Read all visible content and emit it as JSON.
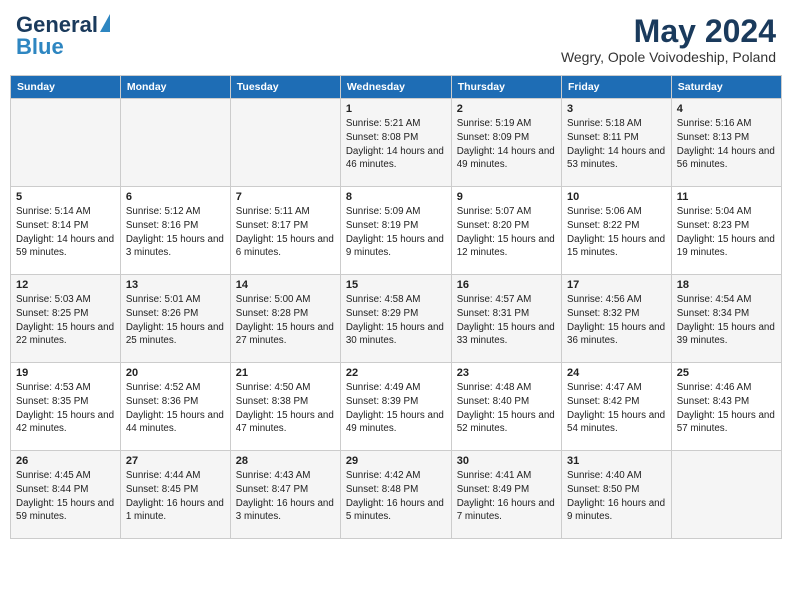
{
  "header": {
    "logo_line1": "General",
    "logo_line2": "Blue",
    "month_title": "May 2024",
    "location": "Wegry, Opole Voivodeship, Poland"
  },
  "columns": [
    "Sunday",
    "Monday",
    "Tuesday",
    "Wednesday",
    "Thursday",
    "Friday",
    "Saturday"
  ],
  "weeks": [
    [
      {
        "day": "",
        "sunrise": "",
        "sunset": "",
        "daylight": ""
      },
      {
        "day": "",
        "sunrise": "",
        "sunset": "",
        "daylight": ""
      },
      {
        "day": "",
        "sunrise": "",
        "sunset": "",
        "daylight": ""
      },
      {
        "day": "1",
        "sunrise": "Sunrise: 5:21 AM",
        "sunset": "Sunset: 8:08 PM",
        "daylight": "Daylight: 14 hours and 46 minutes."
      },
      {
        "day": "2",
        "sunrise": "Sunrise: 5:19 AM",
        "sunset": "Sunset: 8:09 PM",
        "daylight": "Daylight: 14 hours and 49 minutes."
      },
      {
        "day": "3",
        "sunrise": "Sunrise: 5:18 AM",
        "sunset": "Sunset: 8:11 PM",
        "daylight": "Daylight: 14 hours and 53 minutes."
      },
      {
        "day": "4",
        "sunrise": "Sunrise: 5:16 AM",
        "sunset": "Sunset: 8:13 PM",
        "daylight": "Daylight: 14 hours and 56 minutes."
      }
    ],
    [
      {
        "day": "5",
        "sunrise": "Sunrise: 5:14 AM",
        "sunset": "Sunset: 8:14 PM",
        "daylight": "Daylight: 14 hours and 59 minutes."
      },
      {
        "day": "6",
        "sunrise": "Sunrise: 5:12 AM",
        "sunset": "Sunset: 8:16 PM",
        "daylight": "Daylight: 15 hours and 3 minutes."
      },
      {
        "day": "7",
        "sunrise": "Sunrise: 5:11 AM",
        "sunset": "Sunset: 8:17 PM",
        "daylight": "Daylight: 15 hours and 6 minutes."
      },
      {
        "day": "8",
        "sunrise": "Sunrise: 5:09 AM",
        "sunset": "Sunset: 8:19 PM",
        "daylight": "Daylight: 15 hours and 9 minutes."
      },
      {
        "day": "9",
        "sunrise": "Sunrise: 5:07 AM",
        "sunset": "Sunset: 8:20 PM",
        "daylight": "Daylight: 15 hours and 12 minutes."
      },
      {
        "day": "10",
        "sunrise": "Sunrise: 5:06 AM",
        "sunset": "Sunset: 8:22 PM",
        "daylight": "Daylight: 15 hours and 15 minutes."
      },
      {
        "day": "11",
        "sunrise": "Sunrise: 5:04 AM",
        "sunset": "Sunset: 8:23 PM",
        "daylight": "Daylight: 15 hours and 19 minutes."
      }
    ],
    [
      {
        "day": "12",
        "sunrise": "Sunrise: 5:03 AM",
        "sunset": "Sunset: 8:25 PM",
        "daylight": "Daylight: 15 hours and 22 minutes."
      },
      {
        "day": "13",
        "sunrise": "Sunrise: 5:01 AM",
        "sunset": "Sunset: 8:26 PM",
        "daylight": "Daylight: 15 hours and 25 minutes."
      },
      {
        "day": "14",
        "sunrise": "Sunrise: 5:00 AM",
        "sunset": "Sunset: 8:28 PM",
        "daylight": "Daylight: 15 hours and 27 minutes."
      },
      {
        "day": "15",
        "sunrise": "Sunrise: 4:58 AM",
        "sunset": "Sunset: 8:29 PM",
        "daylight": "Daylight: 15 hours and 30 minutes."
      },
      {
        "day": "16",
        "sunrise": "Sunrise: 4:57 AM",
        "sunset": "Sunset: 8:31 PM",
        "daylight": "Daylight: 15 hours and 33 minutes."
      },
      {
        "day": "17",
        "sunrise": "Sunrise: 4:56 AM",
        "sunset": "Sunset: 8:32 PM",
        "daylight": "Daylight: 15 hours and 36 minutes."
      },
      {
        "day": "18",
        "sunrise": "Sunrise: 4:54 AM",
        "sunset": "Sunset: 8:34 PM",
        "daylight": "Daylight: 15 hours and 39 minutes."
      }
    ],
    [
      {
        "day": "19",
        "sunrise": "Sunrise: 4:53 AM",
        "sunset": "Sunset: 8:35 PM",
        "daylight": "Daylight: 15 hours and 42 minutes."
      },
      {
        "day": "20",
        "sunrise": "Sunrise: 4:52 AM",
        "sunset": "Sunset: 8:36 PM",
        "daylight": "Daylight: 15 hours and 44 minutes."
      },
      {
        "day": "21",
        "sunrise": "Sunrise: 4:50 AM",
        "sunset": "Sunset: 8:38 PM",
        "daylight": "Daylight: 15 hours and 47 minutes."
      },
      {
        "day": "22",
        "sunrise": "Sunrise: 4:49 AM",
        "sunset": "Sunset: 8:39 PM",
        "daylight": "Daylight: 15 hours and 49 minutes."
      },
      {
        "day": "23",
        "sunrise": "Sunrise: 4:48 AM",
        "sunset": "Sunset: 8:40 PM",
        "daylight": "Daylight: 15 hours and 52 minutes."
      },
      {
        "day": "24",
        "sunrise": "Sunrise: 4:47 AM",
        "sunset": "Sunset: 8:42 PM",
        "daylight": "Daylight: 15 hours and 54 minutes."
      },
      {
        "day": "25",
        "sunrise": "Sunrise: 4:46 AM",
        "sunset": "Sunset: 8:43 PM",
        "daylight": "Daylight: 15 hours and 57 minutes."
      }
    ],
    [
      {
        "day": "26",
        "sunrise": "Sunrise: 4:45 AM",
        "sunset": "Sunset: 8:44 PM",
        "daylight": "Daylight: 15 hours and 59 minutes."
      },
      {
        "day": "27",
        "sunrise": "Sunrise: 4:44 AM",
        "sunset": "Sunset: 8:45 PM",
        "daylight": "Daylight: 16 hours and 1 minute."
      },
      {
        "day": "28",
        "sunrise": "Sunrise: 4:43 AM",
        "sunset": "Sunset: 8:47 PM",
        "daylight": "Daylight: 16 hours and 3 minutes."
      },
      {
        "day": "29",
        "sunrise": "Sunrise: 4:42 AM",
        "sunset": "Sunset: 8:48 PM",
        "daylight": "Daylight: 16 hours and 5 minutes."
      },
      {
        "day": "30",
        "sunrise": "Sunrise: 4:41 AM",
        "sunset": "Sunset: 8:49 PM",
        "daylight": "Daylight: 16 hours and 7 minutes."
      },
      {
        "day": "31",
        "sunrise": "Sunrise: 4:40 AM",
        "sunset": "Sunset: 8:50 PM",
        "daylight": "Daylight: 16 hours and 9 minutes."
      },
      {
        "day": "",
        "sunrise": "",
        "sunset": "",
        "daylight": ""
      }
    ]
  ]
}
